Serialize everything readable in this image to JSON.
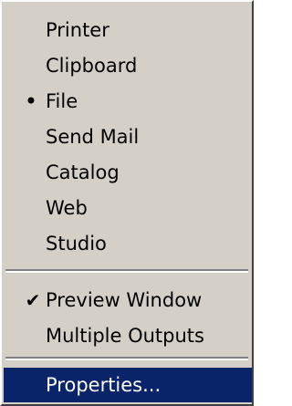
{
  "menu": {
    "output_items": [
      {
        "label": "Printer",
        "mark": ""
      },
      {
        "label": "Clipboard",
        "mark": ""
      },
      {
        "label": "File",
        "mark": "•"
      },
      {
        "label": "Send Mail",
        "mark": ""
      },
      {
        "label": "Catalog",
        "mark": ""
      },
      {
        "label": "Web",
        "mark": ""
      },
      {
        "label": "Studio",
        "mark": ""
      }
    ],
    "option_items": [
      {
        "label": "Preview Window",
        "mark": "✔"
      },
      {
        "label": "Multiple Outputs",
        "mark": ""
      }
    ],
    "properties_label": "Properties..."
  },
  "colors": {
    "menu_background": "#d4d0c8",
    "highlight": "#0a246a",
    "highlight_text": "#ffffff"
  }
}
